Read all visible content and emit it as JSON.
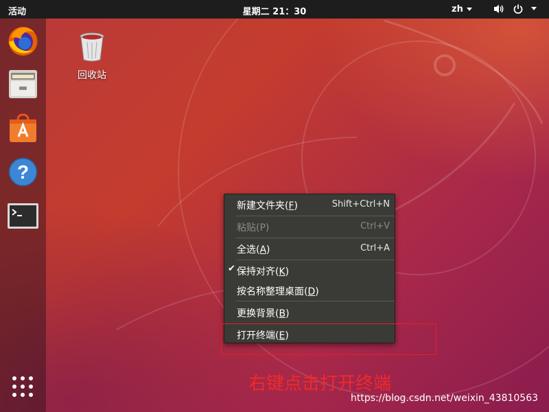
{
  "top_panel": {
    "activities": "活动",
    "clock": "星期二 21：30",
    "language": "zh",
    "tray_icons": [
      "volume-icon",
      "power-icon",
      "chevron-down-icon"
    ]
  },
  "dock": {
    "items": [
      "firefox-icon",
      "files-icon",
      "software-center-icon",
      "help-icon",
      "terminal-icon"
    ],
    "show_apps": "app-grid-icon"
  },
  "desktop": {
    "trash_label": "回收站"
  },
  "context_menu": {
    "items": [
      {
        "label": "新建文件夹(",
        "mnemonic": "F",
        "tail": ")",
        "accel": "Shift+Ctrl+N",
        "enabled": true
      },
      {
        "label": "粘贴(P)",
        "mnemonic": "",
        "tail": "",
        "accel": "Ctrl+V",
        "enabled": false
      },
      {
        "label": "全选(",
        "mnemonic": "A",
        "tail": ")",
        "accel": "Ctrl+A",
        "enabled": true
      },
      {
        "label": "保持对齐(",
        "mnemonic": "K",
        "tail": ")",
        "accel": "",
        "enabled": true,
        "checked": true
      },
      {
        "label": "按名称整理桌面(",
        "mnemonic": "D",
        "tail": ")",
        "accel": "",
        "enabled": true
      },
      {
        "label": "更换背景(",
        "mnemonic": "B",
        "tail": ")",
        "accel": "",
        "enabled": true
      },
      {
        "label": "打开终端(",
        "mnemonic": "E",
        "tail": ")",
        "accel": "",
        "enabled": true
      }
    ]
  },
  "annotation": {
    "text": "右键点击打开终端",
    "color": "#f02a2a"
  },
  "watermark": "https://blog.csdn.net/weixin_43810563"
}
